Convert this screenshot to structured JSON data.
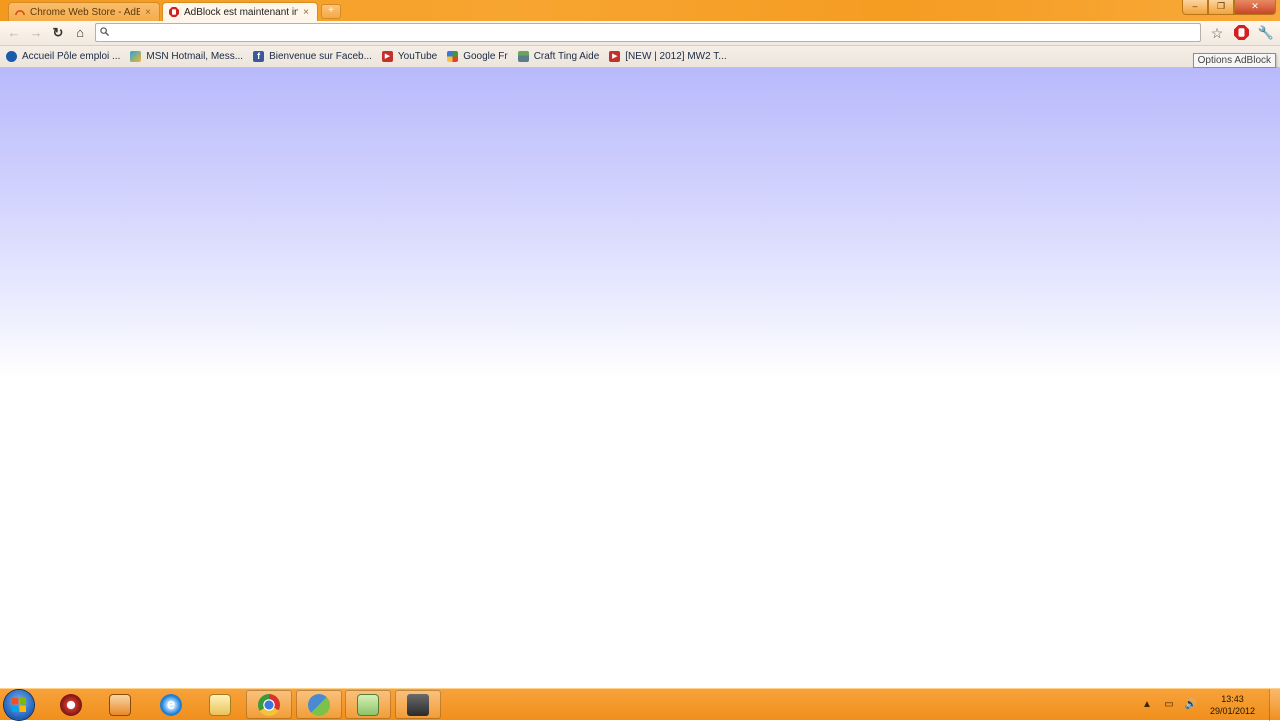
{
  "tabs": [
    {
      "title": "Chrome Web Store - AdBlo",
      "close": "×",
      "active": false,
      "icon": "chrome-web-store-icon"
    },
    {
      "title": "AdBlock est maintenant ins",
      "close": "×",
      "active": true,
      "icon": "adblock-icon"
    }
  ],
  "new_tab_label": "+",
  "window_controls": {
    "minimize": "–",
    "maximize": "❐",
    "close": "✕"
  },
  "toolbar": {
    "back": "←",
    "forward": "→",
    "reload": "↻",
    "home": "⌂",
    "omnibox_value": "",
    "star": "☆",
    "wrench": "🔧"
  },
  "bookmarks": [
    {
      "label": "Accueil Pôle emploi ...",
      "icon": "pole-emploi-icon",
      "color": "#1b5aa8"
    },
    {
      "label": "MSN Hotmail, Mess...",
      "icon": "msn-butterfly-icon",
      "color": "#2aa4d8"
    },
    {
      "label": "Bienvenue sur Faceb...",
      "icon": "facebook-icon",
      "color": "#3b5998"
    },
    {
      "label": "YouTube",
      "icon": "youtube-icon",
      "color": "#c4302b"
    },
    {
      "label": "Google Fr",
      "icon": "google-icon",
      "color": "#3b9a3b"
    },
    {
      "label": "Craft Ting  Aide",
      "icon": "minecraft-block-icon",
      "color": "#5a7d8c"
    },
    {
      "label": "[NEW | 2012] MW2 T...",
      "icon": "youtube-icon",
      "color": "#c4302b"
    }
  ],
  "tooltip": "Options AdBlock",
  "taskbar": {
    "items": [
      {
        "name": "quicktime-icon",
        "color": "#c9372c",
        "running": false
      },
      {
        "name": "media-player-icon",
        "color": "#e88a2a",
        "running": false
      },
      {
        "name": "internet-explorer-icon",
        "color": "#1f7fd6",
        "running": false
      },
      {
        "name": "file-explorer-icon",
        "color": "#e9c35a",
        "running": false
      },
      {
        "name": "chrome-icon",
        "color": "#d8322b",
        "running": true
      },
      {
        "name": "messenger-icon",
        "color": "#4a8ad0",
        "running": true
      },
      {
        "name": "notes-app-icon",
        "color": "#8cc36a",
        "running": true
      },
      {
        "name": "video-camera-icon",
        "color": "#3b3b3b",
        "running": true
      }
    ],
    "tray": {
      "expand": "▲",
      "network": "▭",
      "volume": "🔊"
    },
    "time": "13:43",
    "date": "29/01/2012"
  }
}
